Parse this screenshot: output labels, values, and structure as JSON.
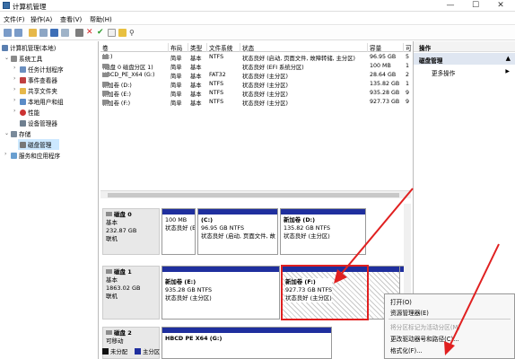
{
  "window": {
    "title": "计算机管理",
    "minimize": "—",
    "maximize": "☐",
    "close": "✕"
  },
  "menu": [
    "文件(F)",
    "操作(A)",
    "查看(V)",
    "帮助(H)"
  ],
  "toolbar_icons": [
    "back-icon",
    "forward-icon",
    "up-folder-icon",
    "properties-icon",
    "help-icon",
    "show-hide-icon",
    "delete-icon",
    "checkmark-icon",
    "new-icon",
    "export-icon",
    "search-icon"
  ],
  "tree": {
    "root": "计算机管理(本地)",
    "items": [
      {
        "label": "系统工具",
        "level": 1,
        "icon": "tools-icon"
      },
      {
        "label": "任务计划程序",
        "level": 2,
        "icon": "clock-icon"
      },
      {
        "label": "事件查看器",
        "level": 2,
        "icon": "event-icon"
      },
      {
        "label": "共享文件夹",
        "level": 2,
        "icon": "folder-icon"
      },
      {
        "label": "本地用户和组",
        "level": 2,
        "icon": "users-icon"
      },
      {
        "label": "性能",
        "level": 2,
        "icon": "performance-icon"
      },
      {
        "label": "设备管理器",
        "level": 2,
        "icon": "device-icon"
      },
      {
        "label": "存储",
        "level": 1,
        "icon": "storage-icon"
      },
      {
        "label": "磁盘管理",
        "level": 2,
        "icon": "disk-icon",
        "selected": true
      },
      {
        "label": "服务和应用程序",
        "level": 1,
        "icon": "services-icon"
      }
    ]
  },
  "volumes": {
    "columns": [
      "卷",
      "布局",
      "类型",
      "文件系统",
      "状态",
      "容量",
      "可"
    ],
    "rows": [
      [
        "(C:)",
        "简单",
        "基本",
        "NTFS",
        "状态良好 (启动, 页面文件, 故障转储, 主分区)",
        "96.95 GB",
        "5"
      ],
      [
        "(磁盘 0 磁盘分区 1)",
        "简单",
        "基本",
        "",
        "状态良好 (EFI 系统分区)",
        "100 MB",
        "1"
      ],
      [
        "HBCD_PE_X64 (G:)",
        "简单",
        "基本",
        "FAT32",
        "状态良好 (主分区)",
        "28.64 GB",
        "2"
      ],
      [
        "新加卷 (D:)",
        "简单",
        "基本",
        "NTFS",
        "状态良好 (主分区)",
        "135.82 GB",
        "1"
      ],
      [
        "新加卷 (E:)",
        "简单",
        "基本",
        "NTFS",
        "状态良好 (主分区)",
        "935.28 GB",
        "9"
      ],
      [
        "新加卷 (F:)",
        "简单",
        "基本",
        "NTFS",
        "状态良好 (主分区)",
        "927.73 GB",
        "9"
      ]
    ]
  },
  "disks": [
    {
      "name": "磁盘 0",
      "type": "基本",
      "size": "232.87 GB",
      "status": "联机",
      "parts": [
        {
          "line1": "",
          "line2": "100 MB",
          "line3": "状态良好 (EFI"
        },
        {
          "line1": "(C:)",
          "line2": "96.95 GB NTFS",
          "line3": "状态良好 (启动, 页面文件, 故"
        },
        {
          "line1": "新加卷 (D:)",
          "line2": "135.82 GB NTFS",
          "line3": "状态良好 (主分区)"
        }
      ]
    },
    {
      "name": "磁盘 1",
      "type": "基本",
      "size": "1863.02 GB",
      "status": "联机",
      "parts": [
        {
          "line1": "新加卷 (E:)",
          "line2": "935.28 GB NTFS",
          "line3": "状态良好 (主分区)"
        },
        {
          "line1": "新加卷 (F:)",
          "line2": "927.73 GB NTFS",
          "line3": "状态良好 (主分区)"
        }
      ]
    },
    {
      "name": "磁盘 2",
      "type": "可移动",
      "size": "",
      "status": "",
      "parts": [
        {
          "line1": "HBCD PE X64 (G:)",
          "line2": "",
          "line3": ""
        }
      ]
    }
  ],
  "legend": [
    "未分配",
    "主分区"
  ],
  "colors": {
    "primary_partition": "#1f2f9e",
    "unallocated": "#111111",
    "highlight": "#e02020",
    "selection": "#cce8ff"
  },
  "ops_panel": {
    "header": "操作",
    "section": "磁盘管理",
    "more": "更多操作",
    "more_arrow": "▶"
  },
  "context_menu": [
    {
      "label": "打开(O)",
      "enabled": true
    },
    {
      "label": "资源管理器(E)",
      "enabled": true
    },
    {
      "label": "将分区标记为活动分区(M)",
      "enabled": false
    },
    {
      "label": "更改驱动器号和路径(C)...",
      "enabled": true
    },
    {
      "label": "格式化(F)...",
      "enabled": true
    }
  ]
}
